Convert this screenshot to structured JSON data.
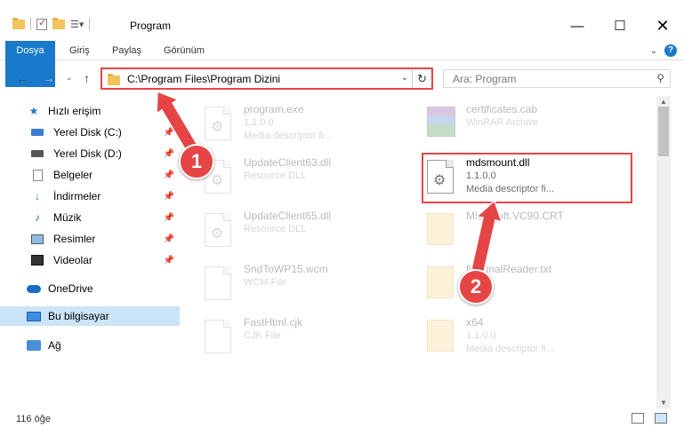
{
  "window": {
    "title": "Program",
    "minimize": "—",
    "maximize": "☐",
    "close": "✕"
  },
  "ribbon": {
    "tabs": [
      "Dosya",
      "Giriş",
      "Paylaş",
      "Görünüm"
    ],
    "expand": "⌄",
    "help": "?"
  },
  "address": {
    "path": "C:\\Program Files\\Program Dizini",
    "dropdown": "⌄",
    "refresh": "↻",
    "search_placeholder": "Ara: Program",
    "back": "←",
    "forward": "→",
    "recent": "⌄",
    "up": "↑"
  },
  "sidebar": {
    "items": [
      {
        "label": "Hızlı erişim",
        "icon": "star-icon"
      },
      {
        "label": "Yerel Disk (C:)",
        "icon": "drive-icon",
        "pinned": true
      },
      {
        "label": "Yerel Disk (D:)",
        "icon": "drive-icon",
        "pinned": true
      },
      {
        "label": "Belgeler",
        "icon": "documents-icon",
        "pinned": true
      },
      {
        "label": "İndirmeler",
        "icon": "download-icon",
        "pinned": true
      },
      {
        "label": "Müzik",
        "icon": "music-icon",
        "pinned": true
      },
      {
        "label": "Resimler",
        "icon": "pictures-icon",
        "pinned": true
      },
      {
        "label": "Videolar",
        "icon": "video-icon",
        "pinned": true
      },
      {
        "label": "OneDrive",
        "icon": "cloud-icon"
      },
      {
        "label": "Bu bilgisayar",
        "icon": "computer-icon",
        "selected": true
      },
      {
        "label": "Ağ",
        "icon": "network-icon"
      }
    ]
  },
  "files": [
    {
      "name": "program.exe",
      "line1": "1.1.0.0",
      "line2": "Media descriptor fi...",
      "faded": true
    },
    {
      "name": "certificates.cab",
      "line1": "WinRAR Archive",
      "line2": "",
      "faded": true
    },
    {
      "name": "UpdateClient63.dll",
      "line1": "Resource DLL",
      "line2": "",
      "faded": true
    },
    {
      "name": "mdsmount.dll",
      "line1": "1.1.0.0",
      "line2": "Media descriptor fi...",
      "faded": false
    },
    {
      "name": "UpdateClient65.dll",
      "line1": "Resource DLL",
      "line2": "",
      "faded": true
    },
    {
      "name": "Microsoft.VC90.CRT",
      "line1": "",
      "line2": "",
      "faded": true
    },
    {
      "name": "SndToWP15.wcm",
      "line1": "WCM File",
      "line2": "",
      "faded": true
    },
    {
      "name": "fileFinalReader.txt",
      "line1": "",
      "line2": "",
      "faded": true
    },
    {
      "name": "FastHtml.cjk",
      "line1": "CJK File",
      "line2": "",
      "faded": true
    },
    {
      "name": "x64",
      "line1": "1.1.0.0",
      "line2": "Media descriptor fi...",
      "faded": true
    }
  ],
  "status": {
    "count": "116 öğe"
  },
  "callouts": [
    "1",
    "2"
  ],
  "colors": {
    "accent": "#1979ca",
    "highlight": "#e64545",
    "selected": "#cce4f7"
  }
}
